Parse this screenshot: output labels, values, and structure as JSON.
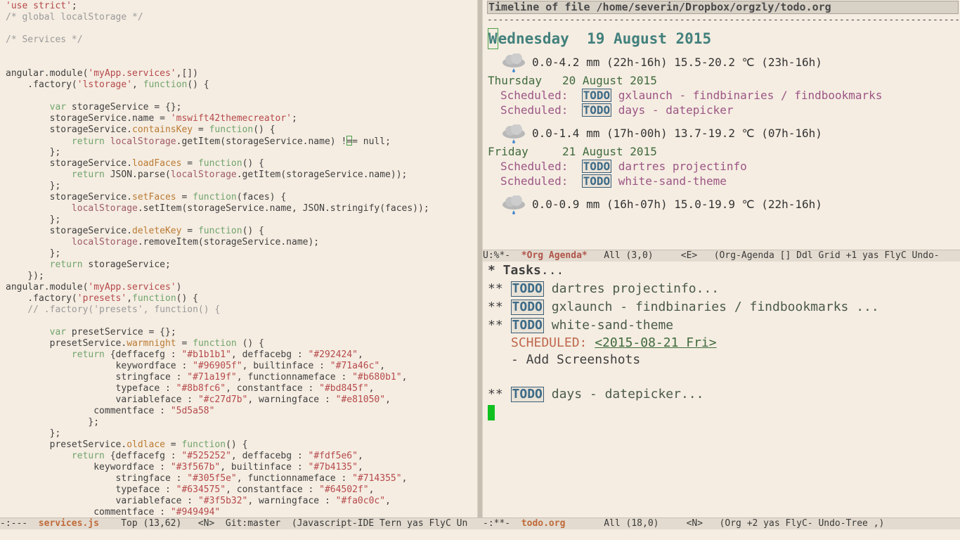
{
  "left_pane": {
    "code_lines": [
      [
        [
          "s",
          "'use strict'"
        ],
        [
          "p",
          ";"
        ]
      ],
      [
        [
          "c",
          "/* global localStorage */"
        ]
      ],
      [],
      [
        [
          "c",
          "/* Services */"
        ]
      ],
      [],
      [],
      [
        [
          "p",
          "angular.module("
        ],
        [
          "s",
          "'myApp.services'"
        ],
        [
          "p",
          ",[])"
        ]
      ],
      [
        [
          "p",
          "    .factory("
        ],
        [
          "s",
          "'lstorage'"
        ],
        [
          "p",
          ", "
        ],
        [
          "k",
          "function"
        ],
        [
          "p",
          "() {"
        ]
      ],
      [],
      [
        [
          "p",
          "        "
        ],
        [
          "k",
          "var"
        ],
        [
          "p",
          " storageService = {};"
        ]
      ],
      [
        [
          "p",
          "        storageService.name = "
        ],
        [
          "s",
          "'mswift42themecreator'"
        ],
        [
          "p",
          ";"
        ]
      ],
      [
        [
          "p",
          "        storageService."
        ],
        [
          "f",
          "containsKey"
        ],
        [
          "p",
          " = "
        ],
        [
          "k",
          "function"
        ],
        [
          "p",
          "() {"
        ]
      ],
      [
        [
          "p",
          "            "
        ],
        [
          "k",
          "return"
        ],
        [
          "p",
          " "
        ],
        [
          "b",
          "localStorage"
        ],
        [
          "p",
          ".getItem(storageService.name) !"
        ],
        [
          "cursor",
          "="
        ],
        [
          "p",
          "= null;"
        ]
      ],
      [
        [
          "p",
          "        };"
        ]
      ],
      [
        [
          "p",
          "        storageService."
        ],
        [
          "f",
          "loadFaces"
        ],
        [
          "p",
          " = "
        ],
        [
          "k",
          "function"
        ],
        [
          "p",
          "() {"
        ]
      ],
      [
        [
          "p",
          "            "
        ],
        [
          "k",
          "return"
        ],
        [
          "p",
          " JSON.parse("
        ],
        [
          "b",
          "localStorage"
        ],
        [
          "p",
          ".getItem(storageService.name));"
        ]
      ],
      [
        [
          "p",
          "        };"
        ]
      ],
      [
        [
          "p",
          "        storageService."
        ],
        [
          "f",
          "setFaces"
        ],
        [
          "p",
          " = "
        ],
        [
          "k",
          "function"
        ],
        [
          "p",
          "(faces) {"
        ]
      ],
      [
        [
          "p",
          "            "
        ],
        [
          "b",
          "localStorage"
        ],
        [
          "p",
          ".setItem(storageService.name, JSON.stringify(faces));"
        ]
      ],
      [
        [
          "p",
          "        };"
        ]
      ],
      [
        [
          "p",
          "        storageService."
        ],
        [
          "f",
          "deleteKey"
        ],
        [
          "p",
          " = "
        ],
        [
          "k",
          "function"
        ],
        [
          "p",
          "() {"
        ]
      ],
      [
        [
          "p",
          "            "
        ],
        [
          "b",
          "localStorage"
        ],
        [
          "p",
          ".removeItem(storageService.name);"
        ]
      ],
      [
        [
          "p",
          "        };"
        ]
      ],
      [
        [
          "p",
          "        "
        ],
        [
          "k",
          "return"
        ],
        [
          "p",
          " storageService;"
        ]
      ],
      [
        [
          "p",
          "    });"
        ]
      ],
      [
        [
          "p",
          "angular.module("
        ],
        [
          "s",
          "'myApp.services'"
        ],
        [
          "p",
          ")"
        ]
      ],
      [
        [
          "p",
          "    .factory("
        ],
        [
          "s",
          "'presets'"
        ],
        [
          "p",
          ","
        ],
        [
          "k",
          "function"
        ],
        [
          "p",
          "() {"
        ]
      ],
      [
        [
          "c",
          "    // .factory('presets', function() {"
        ]
      ],
      [],
      [
        [
          "p",
          "        "
        ],
        [
          "k",
          "var"
        ],
        [
          "p",
          " presetService = {};"
        ]
      ],
      [
        [
          "p",
          "        presetService."
        ],
        [
          "f",
          "warmnight"
        ],
        [
          "p",
          " = "
        ],
        [
          "k",
          "function"
        ],
        [
          "p",
          " () {"
        ]
      ],
      [
        [
          "p",
          "            "
        ],
        [
          "k",
          "return"
        ],
        [
          "p",
          " {deffacefg : "
        ],
        [
          "s",
          "\"#b1b1b1\""
        ],
        [
          "p",
          ", deffacebg : "
        ],
        [
          "s",
          "\"#292424\""
        ],
        [
          "p",
          ","
        ]
      ],
      [
        [
          "p",
          "                    keywordface : "
        ],
        [
          "s",
          "\"#96905f\""
        ],
        [
          "p",
          ", builtinface : "
        ],
        [
          "s",
          "\"#71a46c\""
        ],
        [
          "p",
          ","
        ]
      ],
      [
        [
          "p",
          "                    stringface : "
        ],
        [
          "s",
          "\"#71a19f\""
        ],
        [
          "p",
          ", functionnameface : "
        ],
        [
          "s",
          "\"#b680b1\""
        ],
        [
          "p",
          ","
        ]
      ],
      [
        [
          "p",
          "                    typeface : "
        ],
        [
          "s",
          "\"#8b8fc6\""
        ],
        [
          "p",
          ", constantface : "
        ],
        [
          "s",
          "\"#bd845f\""
        ],
        [
          "p",
          ","
        ]
      ],
      [
        [
          "p",
          "                    variableface : "
        ],
        [
          "s",
          "\"#c27d7b\""
        ],
        [
          "p",
          ", warningface : "
        ],
        [
          "s",
          "\"#e81050\""
        ],
        [
          "p",
          ","
        ]
      ],
      [
        [
          "p",
          "                commentface : "
        ],
        [
          "s",
          "\"5d5a58\""
        ]
      ],
      [
        [
          "p",
          "               };"
        ]
      ],
      [
        [
          "p",
          "        };"
        ]
      ],
      [
        [
          "p",
          "        presetService."
        ],
        [
          "f",
          "oldlace"
        ],
        [
          "p",
          " = "
        ],
        [
          "k",
          "function"
        ],
        [
          "p",
          "() {"
        ]
      ],
      [
        [
          "p",
          "            "
        ],
        [
          "k",
          "return"
        ],
        [
          "p",
          " {deffacefg : "
        ],
        [
          "s",
          "\"#525252\""
        ],
        [
          "p",
          ", deffacebg : "
        ],
        [
          "s",
          "\"#fdf5e6\""
        ],
        [
          "p",
          ","
        ]
      ],
      [
        [
          "p",
          "                keywordface : "
        ],
        [
          "s",
          "\"#3f567b\""
        ],
        [
          "p",
          ", builtinface : "
        ],
        [
          "s",
          "\"#7b4135\""
        ],
        [
          "p",
          ","
        ]
      ],
      [
        [
          "p",
          "                    stringface : "
        ],
        [
          "s",
          "\"#305f5e\""
        ],
        [
          "p",
          ", functionnameface : "
        ],
        [
          "s",
          "\"#714355\""
        ],
        [
          "p",
          ","
        ]
      ],
      [
        [
          "p",
          "                    typeface : "
        ],
        [
          "s",
          "\"#634575\""
        ],
        [
          "p",
          ", constantface : "
        ],
        [
          "s",
          "\"#64502f\""
        ],
        [
          "p",
          ","
        ]
      ],
      [
        [
          "p",
          "                    variableface : "
        ],
        [
          "s",
          "\"#3f5b32\""
        ],
        [
          "p",
          ", warningface : "
        ],
        [
          "s",
          "\"#fa0c0c\""
        ],
        [
          "p",
          ","
        ]
      ],
      [
        [
          "p",
          "                commentface : "
        ],
        [
          "s",
          "\"#949494\""
        ]
      ]
    ],
    "modeline": {
      "prefix": "-:---  ",
      "buffer": "services.js",
      "rest": "    Top (13,62)   <N>  Git:master  (Javascript-IDE Tern yas FlyC Un"
    }
  },
  "agenda": {
    "header": "Timeline of file /home/severin/Dropbox/orgzly/todo.org",
    "separator": "-------------------------------------------------------------------------------------------------------",
    "today": {
      "first_letter": "W",
      "rest": "ednesday  19 August 2015"
    },
    "weather": [
      "0.0-4.2 mm (22h-16h) 15.5-20.2 ℃ (23h-16h)",
      "0.0-1.4 mm (17h-00h) 13.7-19.2 ℃ (07h-16h)",
      "0.0-0.9 mm (16h-07h) 15.0-19.9 ℃ (22h-16h)"
    ],
    "days": [
      "Thursday   20 August 2015",
      "Friday     21 August 2015"
    ],
    "scheduled_label": "Scheduled:",
    "todo_keyword": "TODO",
    "items": [
      "gxlaunch - findbinaries / findbookmarks",
      "days - datepicker",
      "dartres projectinfo",
      "white-sand-theme"
    ],
    "modeline": {
      "prefix": "U:%*-  ",
      "buffer": "*Org Agenda*",
      "rest": "   All (3,0)     <E>   (Org-Agenda [] Ddl Grid +1 yas FlyC Undo-"
    }
  },
  "org": {
    "tasks_heading": "* Tasks",
    "ellipsis": "...",
    "level2_stars": "**",
    "todo_keyword": "TODO",
    "headings": [
      "dartres projectinfo...",
      "gxlaunch - findbinaries / findbookmarks ...",
      "white-sand-theme",
      "days - datepicker..."
    ],
    "scheduled_keyword": "SCHEDULED:",
    "scheduled_timestamp": "<2015-08-21 Fri>",
    "note": "- Add Screenshots",
    "modeline": {
      "prefix": "-:**-  ",
      "buffer": "todo.org",
      "rest": "       All (18,0)     <N>   (Org +2 yas FlyC- Undo-Tree ,)"
    }
  }
}
